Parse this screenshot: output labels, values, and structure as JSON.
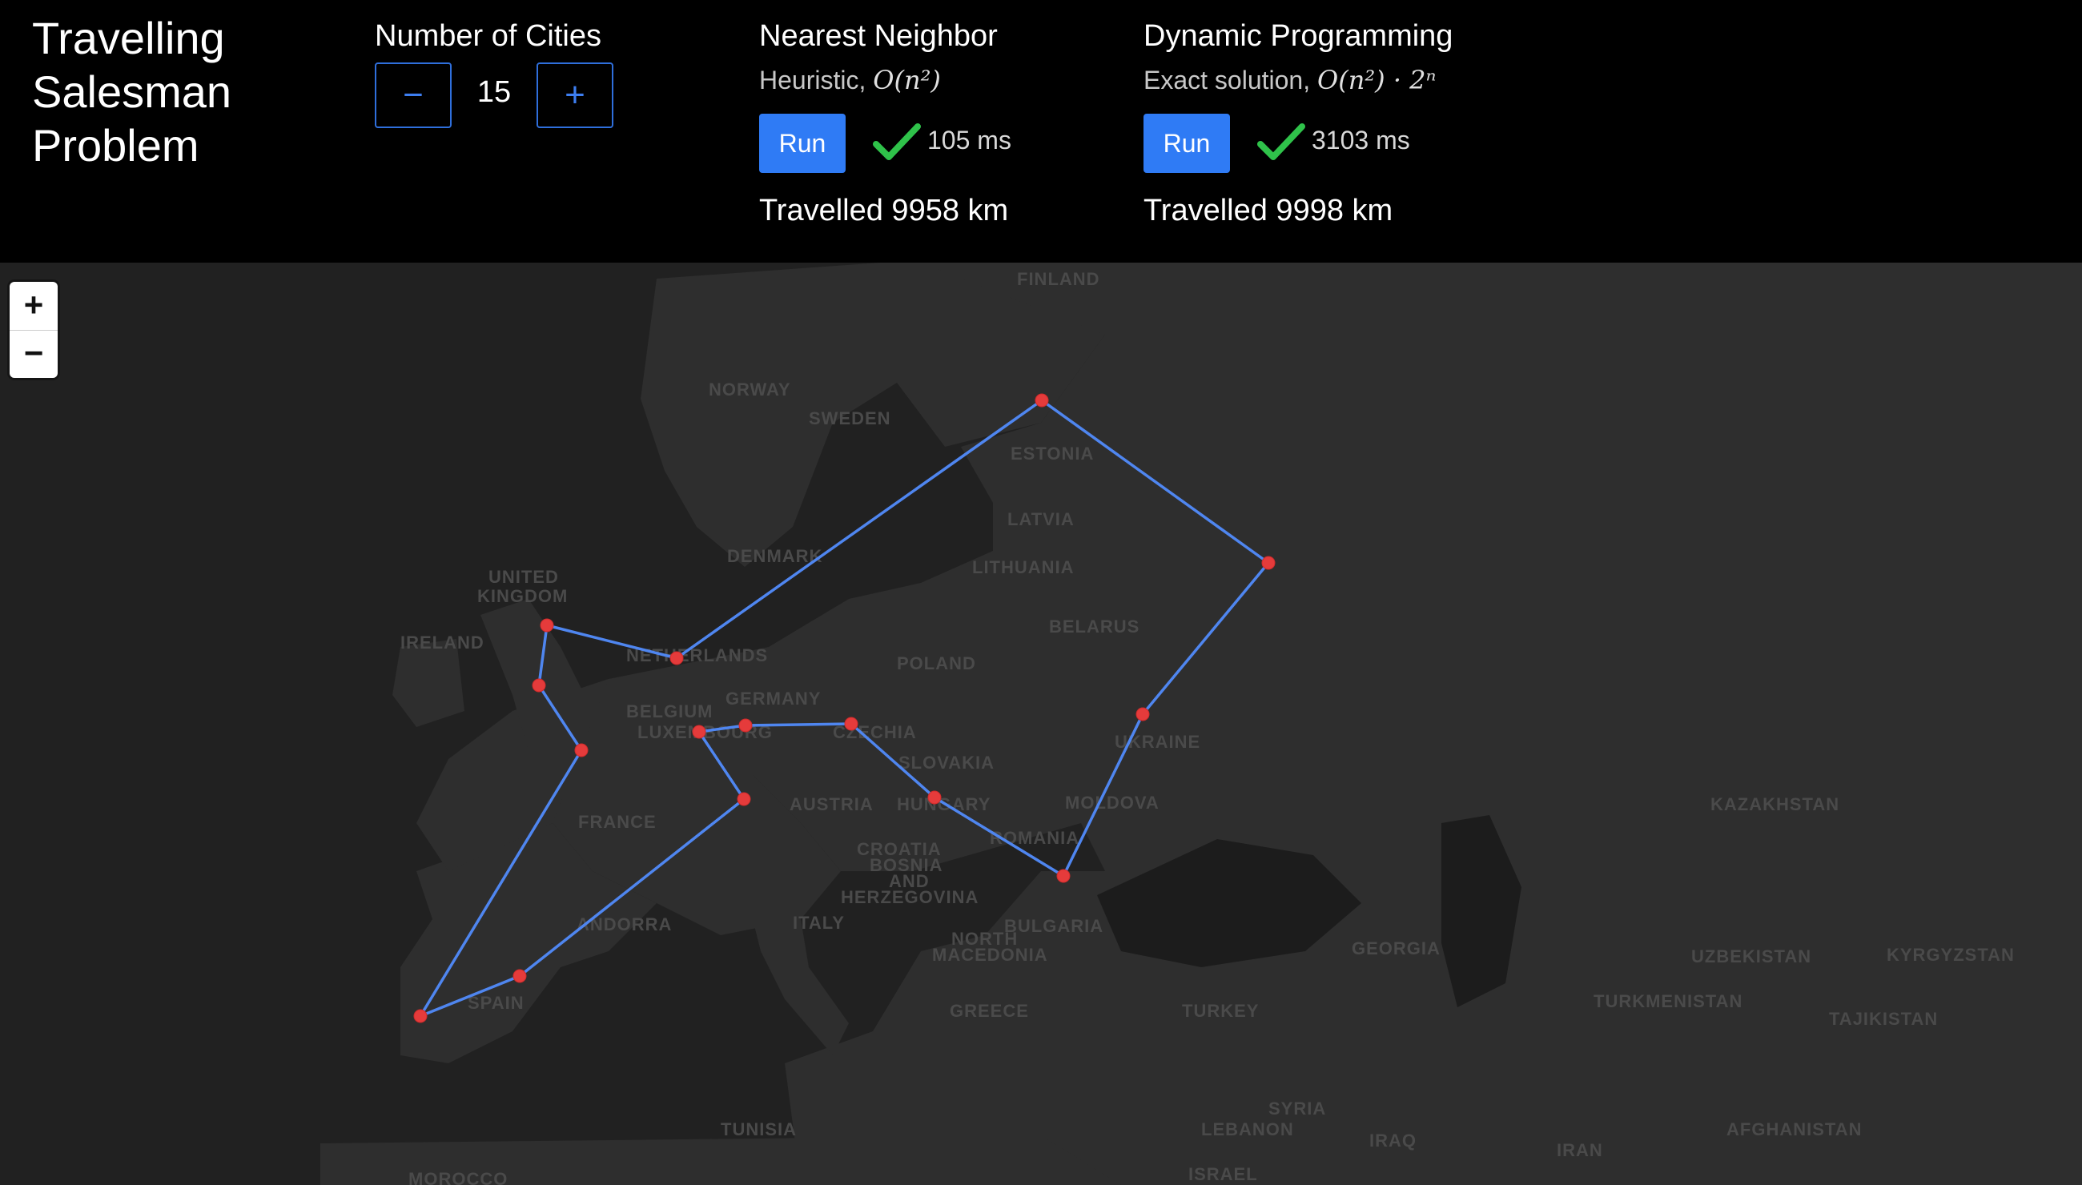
{
  "header": {
    "title": "Travelling Salesman Problem",
    "cities_label": "Number of Cities",
    "minus_label": "−",
    "plus_label": "+",
    "city_count": "15"
  },
  "algorithms": {
    "nn": {
      "title": "Nearest Neighbor",
      "subtitle_text": "Heuristic, ",
      "complexity": "O(n²)",
      "run_label": "Run",
      "status_icon": "check-icon",
      "time": "105 ms",
      "distance": "Travelled 9958 km"
    },
    "dp": {
      "title": "Dynamic Programming",
      "subtitle_text": "Exact solution, ",
      "complexity": "O(n²) · 2ⁿ",
      "run_label": "Run",
      "status_icon": "check-icon",
      "time": "3103 ms",
      "distance": "Travelled 9998 km"
    }
  },
  "map": {
    "zoom_in_label": "+",
    "zoom_out_label": "−",
    "route_color": "#4f86f0",
    "city_color": "#e53b3b",
    "country_labels": [
      "FINLAND",
      "NORWAY",
      "SWEDEN",
      "ESTONIA",
      "LATVIA",
      "DENMARK",
      "LITHUANIA",
      "UNITED",
      "KINGDOM",
      "IRELAND",
      "NETHERLANDS",
      "BELARUS",
      "POLAND",
      "GERMANY",
      "BELGIUM",
      "LUXEMBOURG",
      "CZECHIA",
      "UKRAINE",
      "SLOVAKIA",
      "FRANCE",
      "AUSTRIA",
      "HUNGARY",
      "MOLDOVA",
      "ROMANIA",
      "CROATIA",
      "BOSNIA",
      "AND",
      "HERZEGOVINA",
      "KAZAKHSTAN",
      "ANDORRA",
      "ITALY",
      "BULGARIA",
      "NORTH",
      "MACEDONIA",
      "GEORGIA",
      "UZBEKISTAN",
      "KYRGYZSTAN",
      "SPAIN",
      "GREECE",
      "TURKEY",
      "TURKMENISTAN",
      "TAJIKISTAN",
      "SYRIA",
      "TUNISIA",
      "LEBANON",
      "IRAQ",
      "IRAN",
      "AFGHANISTAN",
      "ISRAEL",
      "MOROCCO"
    ]
  }
}
